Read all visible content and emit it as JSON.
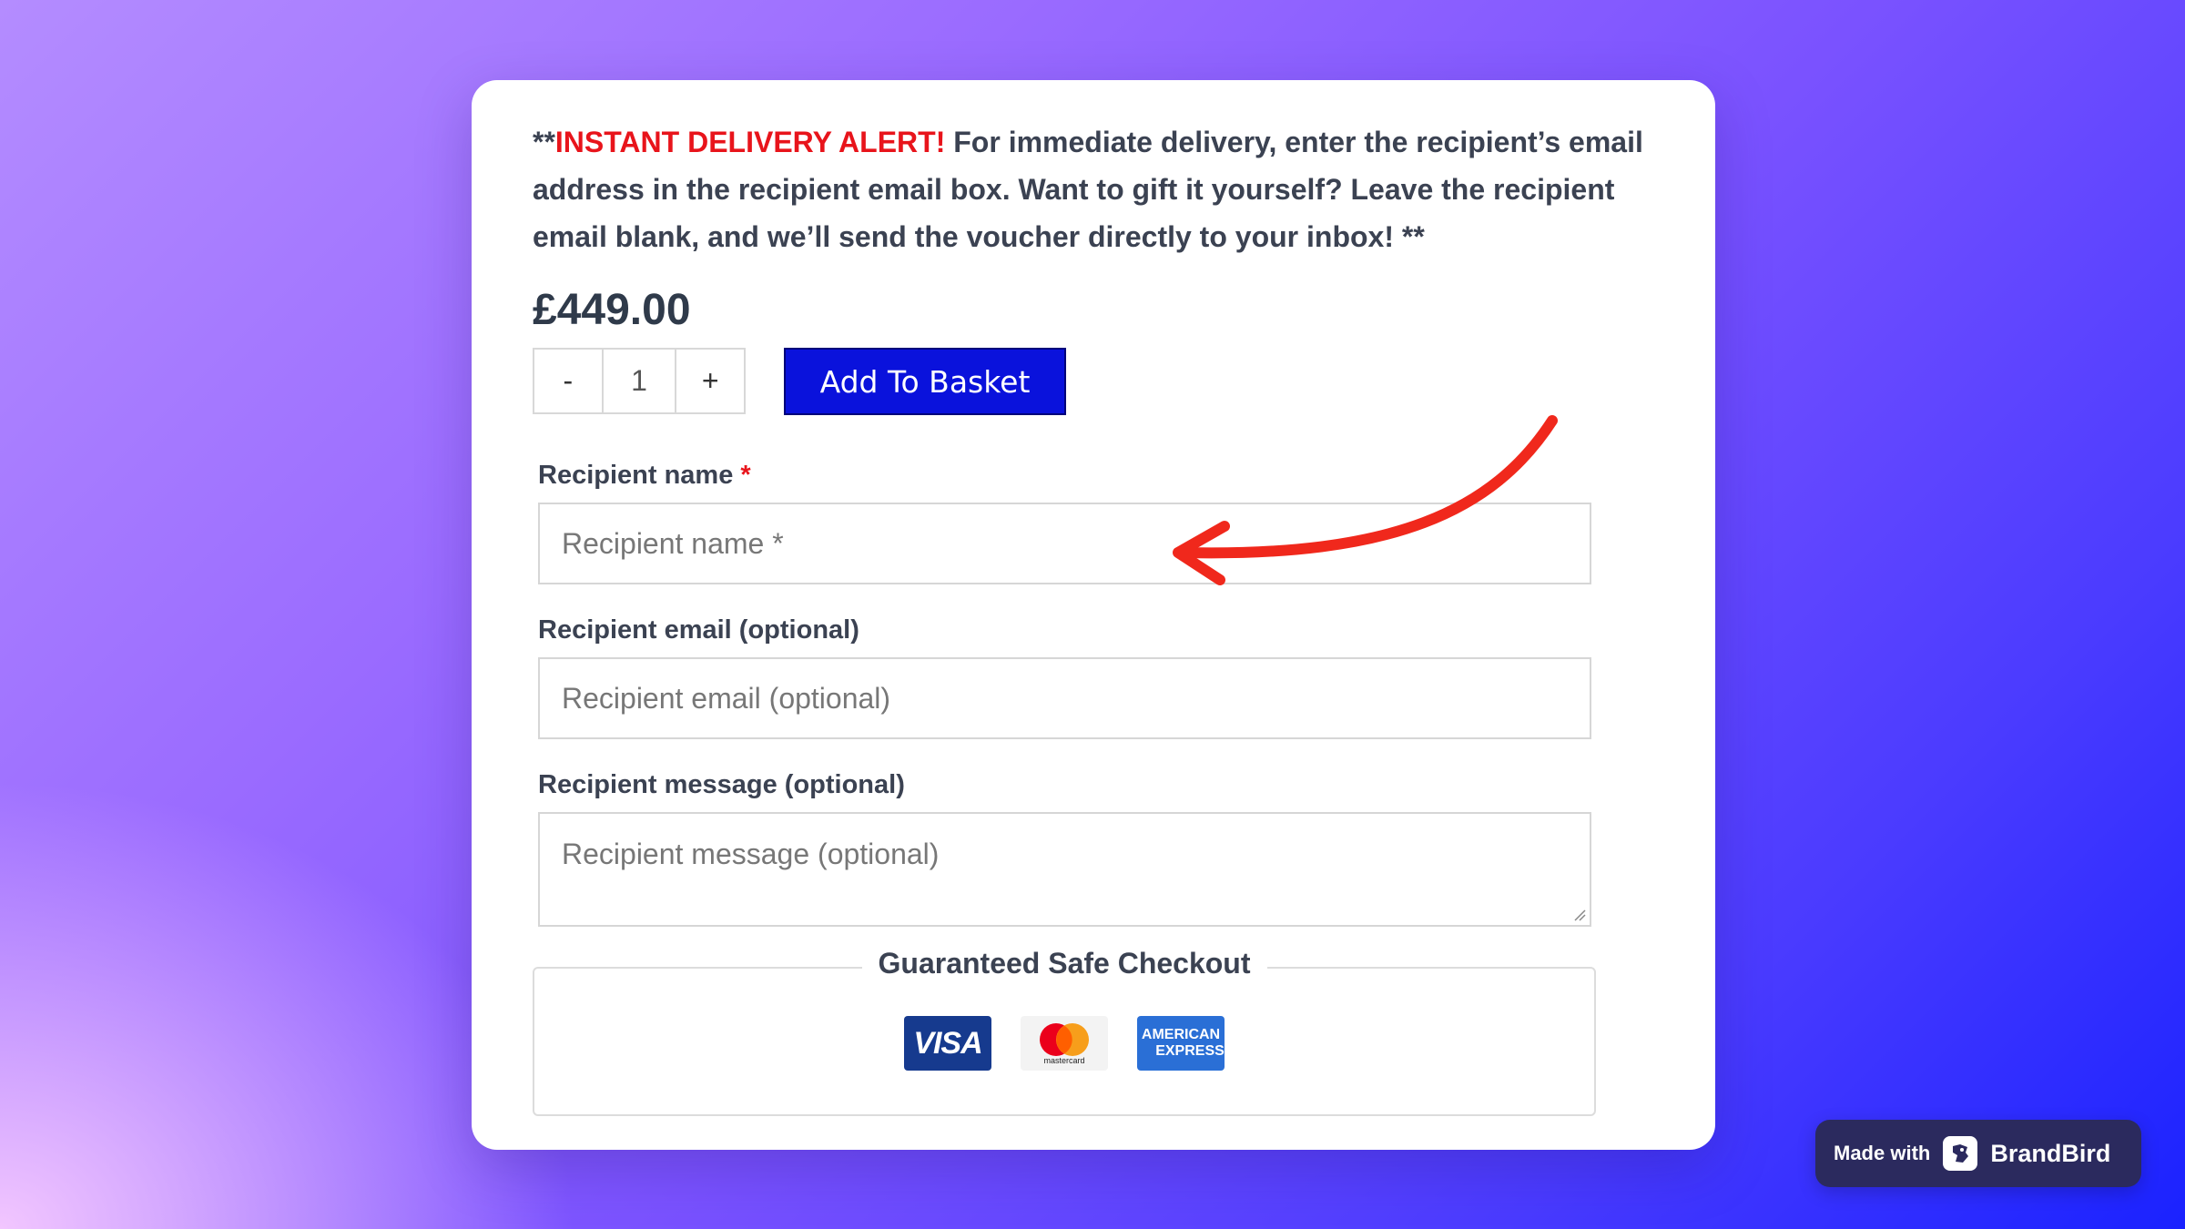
{
  "intro": {
    "prefix": "**",
    "alert": "INSTANT DELIVERY ALERT!",
    "body": " For immediate delivery, enter the recipient’s email address in the recipient email box. Want to gift it yourself? Leave the recipient email blank, and we’ll send the voucher directly to your inbox! **"
  },
  "product": {
    "price": "£449.00",
    "quantity": "1",
    "decrement_label": "-",
    "increment_label": "+",
    "add_to_basket_label": "Add To Basket"
  },
  "form": {
    "recipient_name": {
      "label": "Recipient name",
      "required_mark": "*",
      "placeholder": "Recipient name *",
      "value": ""
    },
    "recipient_email": {
      "label": "Recipient email (optional)",
      "placeholder": "Recipient email (optional)",
      "value": ""
    },
    "recipient_message": {
      "label": "Recipient message (optional)",
      "placeholder": "Recipient message (optional)",
      "value": ""
    }
  },
  "checkout": {
    "title": "Guaranteed Safe Checkout",
    "payment_methods": [
      {
        "name": "visa",
        "text": "VISA"
      },
      {
        "name": "mastercard",
        "text": "mastercard"
      },
      {
        "name": "amex",
        "text_line1": "AMERICAN",
        "text_line2": "EXPRESS"
      }
    ]
  },
  "colors": {
    "accent_button": "#0a12dc",
    "alert_red": "#e8141b",
    "annotation_arrow": "#f0281c"
  },
  "badge": {
    "made_with": "Made with",
    "brand": "BrandBird"
  }
}
